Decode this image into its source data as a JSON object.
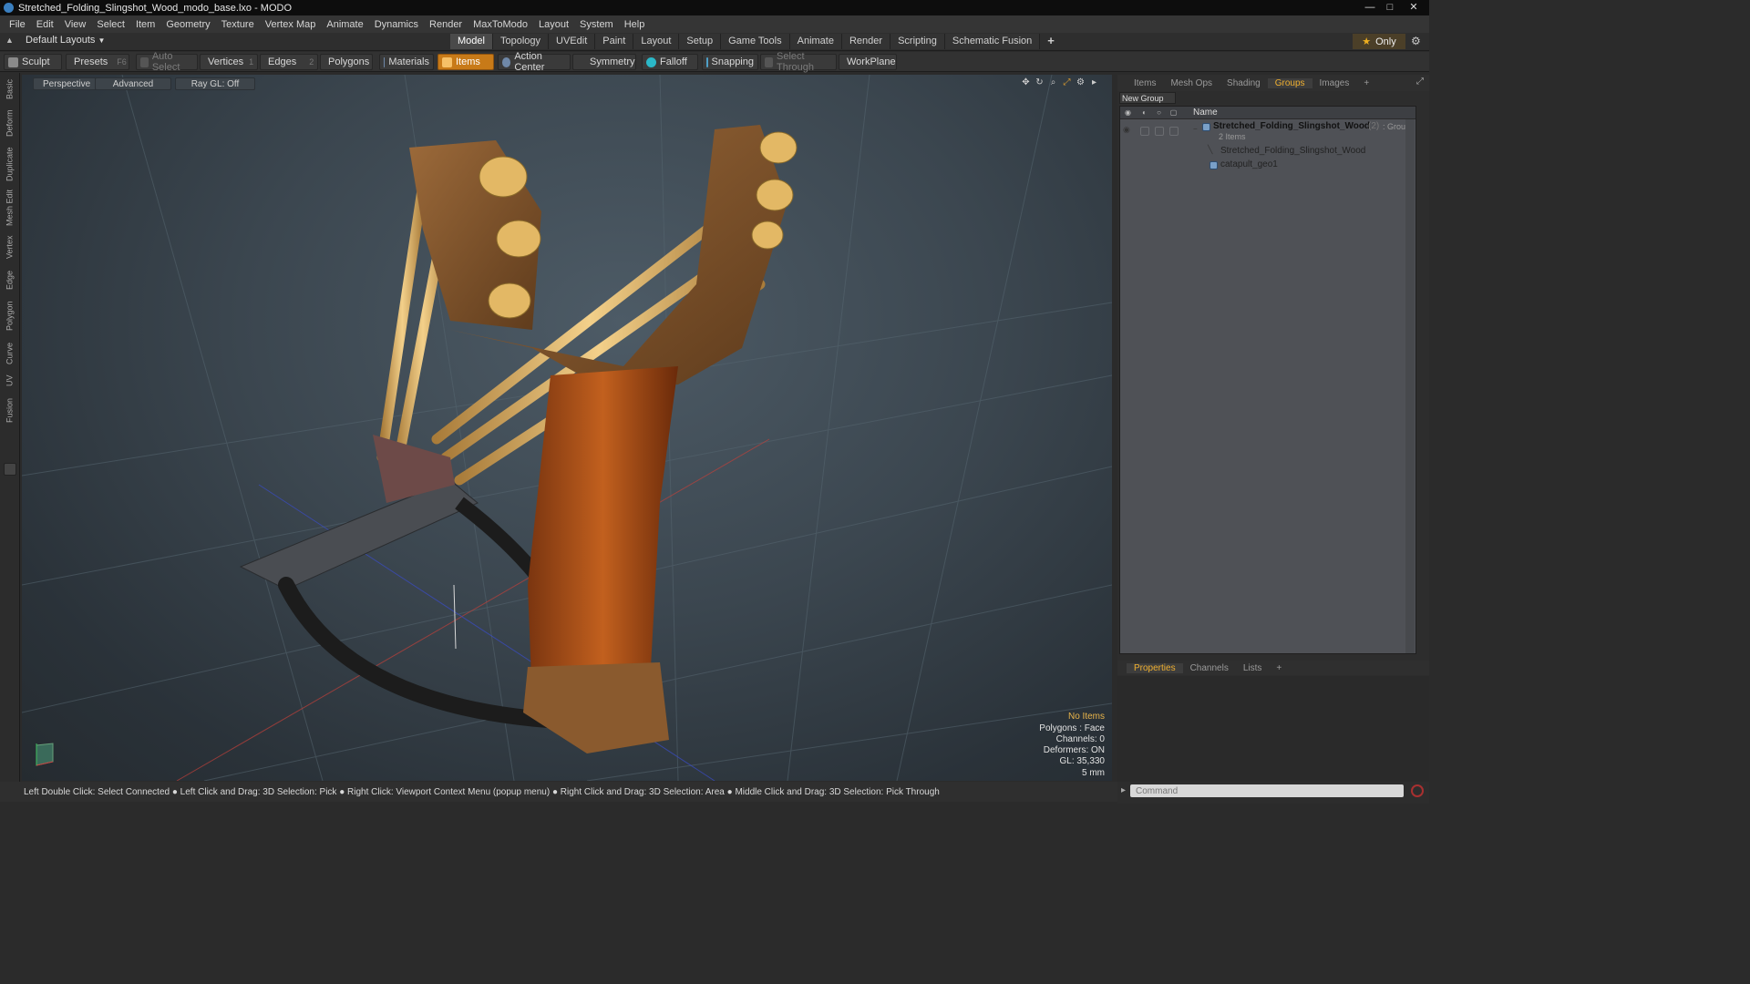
{
  "window": {
    "title": "Stretched_Folding_Slingshot_Wood_modo_base.lxo - MODO",
    "controls": [
      "minimize-icon",
      "maximize-icon",
      "close-icon"
    ]
  },
  "menu": [
    "File",
    "Edit",
    "View",
    "Select",
    "Item",
    "Geometry",
    "Texture",
    "Vertex Map",
    "Animate",
    "Dynamics",
    "Render",
    "MaxToModo",
    "Layout",
    "System",
    "Help"
  ],
  "layout_selector": {
    "label": "Default Layouts"
  },
  "mode_tabs": [
    "Model",
    "Topology",
    "UVEdit",
    "Paint",
    "Layout",
    "Setup",
    "Game Tools",
    "Animate",
    "Render",
    "Scripting",
    "Schematic Fusion"
  ],
  "active_mode_tab": "Model",
  "only_button": "Only",
  "toolbar": {
    "sculpt": "Sculpt",
    "presets": "Presets",
    "presets_key": "F6",
    "auto_select": "Auto Select",
    "vertices": "Vertices",
    "vertices_key": "1",
    "edges": "Edges",
    "edges_key": "2",
    "polygons": "Polygons",
    "materials": "Materials",
    "items": "Items",
    "action_center": "Action Center",
    "symmetry": "Symmetry",
    "falloff": "Falloff",
    "snapping": "Snapping",
    "select_through": "Select Through",
    "workplane": "WorkPlane"
  },
  "left_tabs": [
    "Basic",
    "Deform",
    "Duplicate",
    "Mesh Edit",
    "Vertex",
    "Edge",
    "Polygon",
    "Curve",
    "UV",
    "Fusion"
  ],
  "viewport": {
    "view": "Perspective",
    "shading": "Advanced",
    "raygl": "Ray GL: Off",
    "info": {
      "selection": "No Items",
      "polygons": "Polygons : Face",
      "channels": "Channels: 0",
      "deformers": "Deformers: ON",
      "gl": "GL: 35,330",
      "scale": "5 mm"
    }
  },
  "status_bar": "Left Double Click: Select Connected ● Left Click and Drag: 3D Selection: Pick ● Right Click: Viewport Context Menu (popup menu) ● Right Click and Drag: 3D Selection: Area ● Middle Click and Drag: 3D Selection: Pick Through",
  "right_panel": {
    "tabs": [
      "Items",
      "Mesh Ops",
      "Shading",
      "Groups",
      "Images"
    ],
    "active_tab": "Groups",
    "new_group": "New Group",
    "column_name": "Name",
    "group": {
      "name": "Stretched_Folding_Slingshot_Wood",
      "count": "(2)",
      "type": ": Group",
      "items_count": "2 Items",
      "children": [
        "Stretched_Folding_Slingshot_Wood",
        "catapult_geo1"
      ]
    },
    "bottom_tabs": [
      "Properties",
      "Channels",
      "Lists"
    ],
    "active_bottom_tab": "Properties",
    "command_placeholder": "Command"
  },
  "colors": {
    "accent": "#f0b030",
    "items_button": "#c87a18",
    "viewport_bg": "#3b464f"
  }
}
